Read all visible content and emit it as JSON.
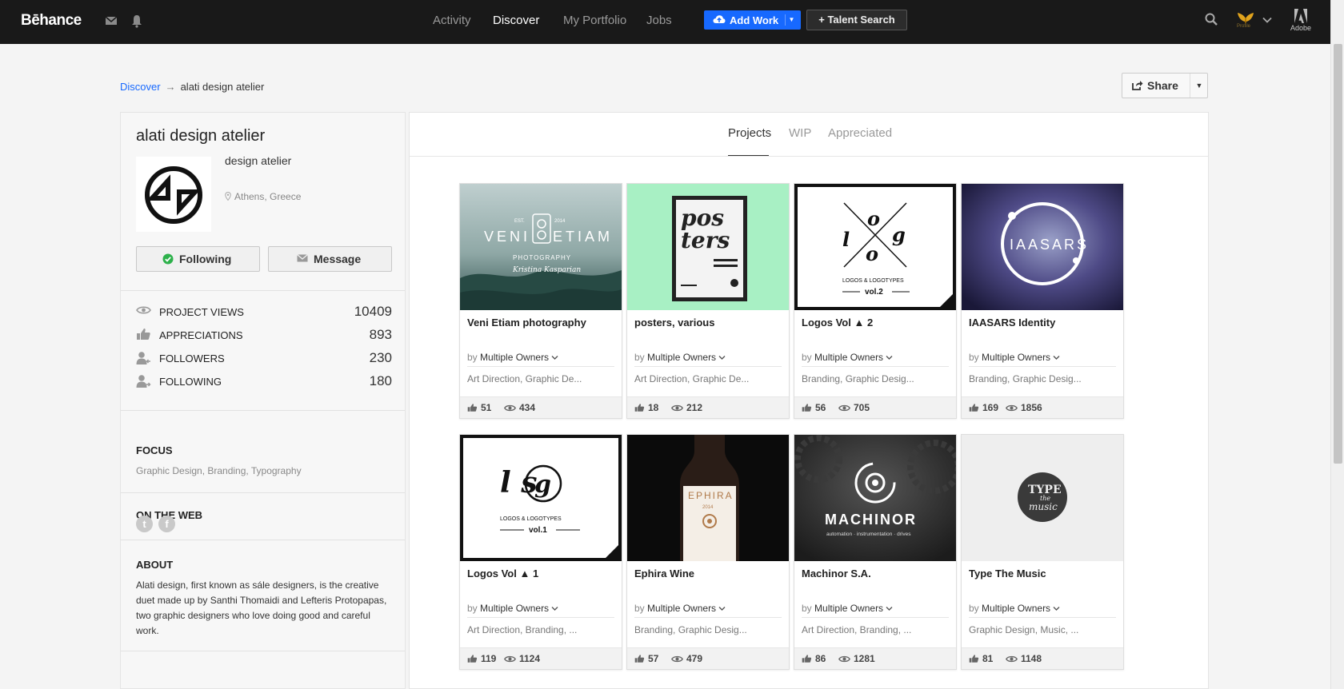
{
  "topbar": {
    "logo": "Bēhance",
    "nav": [
      {
        "label": "Activity",
        "active": false
      },
      {
        "label": "Discover",
        "active": true
      },
      {
        "label": "My Portfolio",
        "active": false
      },
      {
        "label": "Jobs",
        "active": false
      }
    ],
    "add_work": "Add Work",
    "talent_search": "+ Talent Search",
    "avatar_label": "Profile",
    "adobe_label": "Adobe"
  },
  "breadcrumb": {
    "root": "Discover",
    "arrow": "→",
    "current": "alati design atelier"
  },
  "share": {
    "label": "Share"
  },
  "profile": {
    "name": "alati design atelier",
    "description": "design atelier",
    "location": "Athens, Greece",
    "following_label": "Following",
    "message_label": "Message",
    "stats": [
      {
        "label": "PROJECT VIEWS",
        "value": "10409",
        "icon": "eye-icon"
      },
      {
        "label": "APPRECIATIONS",
        "value": "893",
        "icon": "thumbs-up-icon"
      },
      {
        "label": "FOLLOWERS",
        "value": "230",
        "icon": "followers-icon"
      },
      {
        "label": "FOLLOWING",
        "value": "180",
        "icon": "following-icon"
      }
    ],
    "focus_title": "FOCUS",
    "focus": "Graphic Design, Branding, Typography",
    "web_title": "ON THE WEB",
    "web_links": [
      "t",
      "f"
    ],
    "about_title": "ABOUT",
    "about": "Alati design, first known as sále designers, is the creative duet made up by Santhi Thomaidi and Lefteris Protopapas, two graphic designers who love doing good and careful work."
  },
  "tabs": [
    "Projects",
    "WIP",
    "Appreciated"
  ],
  "projects": [
    {
      "title": "Veni Etiam photography",
      "by": "by",
      "owners": "Multiple Owners",
      "fields": "Art Direction, Graphic De...",
      "appreciations": "51",
      "views": "434"
    },
    {
      "title": "posters, various",
      "by": "by",
      "owners": "Multiple Owners",
      "fields": "Art Direction, Graphic De...",
      "appreciations": "18",
      "views": "212"
    },
    {
      "title": "Logos Vol ▲ 2",
      "by": "by",
      "owners": "Multiple Owners",
      "fields": "Branding, Graphic Desig...",
      "appreciations": "56",
      "views": "705"
    },
    {
      "title": "IAASARS Identity",
      "by": "by",
      "owners": "Multiple Owners",
      "fields": "Branding, Graphic Desig...",
      "appreciations": "169",
      "views": "1856"
    },
    {
      "title": "Logos Vol ▲ 1",
      "by": "by",
      "owners": "Multiple Owners",
      "fields": "Art Direction, Branding, ...",
      "appreciations": "119",
      "views": "1124"
    },
    {
      "title": "Ephira Wine",
      "by": "by",
      "owners": "Multiple Owners",
      "fields": "Branding, Graphic Desig...",
      "appreciations": "57",
      "views": "479"
    },
    {
      "title": "Machinor S.A.",
      "by": "by",
      "owners": "Multiple Owners",
      "fields": "Art Direction, Branding, ...",
      "appreciations": "86",
      "views": "1281"
    },
    {
      "title": "Type The Music",
      "by": "by",
      "owners": "Multiple Owners",
      "fields": "Graphic Design, Music, ...",
      "appreciations": "81",
      "views": "1148"
    }
  ],
  "covers": {
    "veni": {
      "est": "EST.",
      "year": "2014",
      "veni": "VENI",
      "etiam": "ETIAM",
      "photography": "PHOTOGRAPHY",
      "signature": "Kristina Kasparian"
    },
    "posters": {
      "line1": "pos",
      "line2": "ters"
    },
    "logos2": {
      "o1": "o",
      "l": "l",
      "g": "g",
      "o2": "o",
      "caption": "LOGOS & LOGOTYPES",
      "vol": "vol.2"
    },
    "iaasars": {
      "text": "IAASARS"
    },
    "logos1": {
      "text": "l  s",
      "g": "g",
      "caption": "LOGOS & LOGOTYPES",
      "vol": "vol.1"
    },
    "ephira": {
      "name": "EPHIRA",
      "year": "2014"
    },
    "machinor": {
      "name": "MACHINOR",
      "tagline": "automation · instrumentation · drives"
    },
    "typemusic": {
      "line1": "TYPE",
      "line2": "the",
      "line3": "music"
    }
  },
  "colors": {
    "accent": "#1769ff",
    "topbar": "#191919",
    "success": "#2db14b"
  }
}
